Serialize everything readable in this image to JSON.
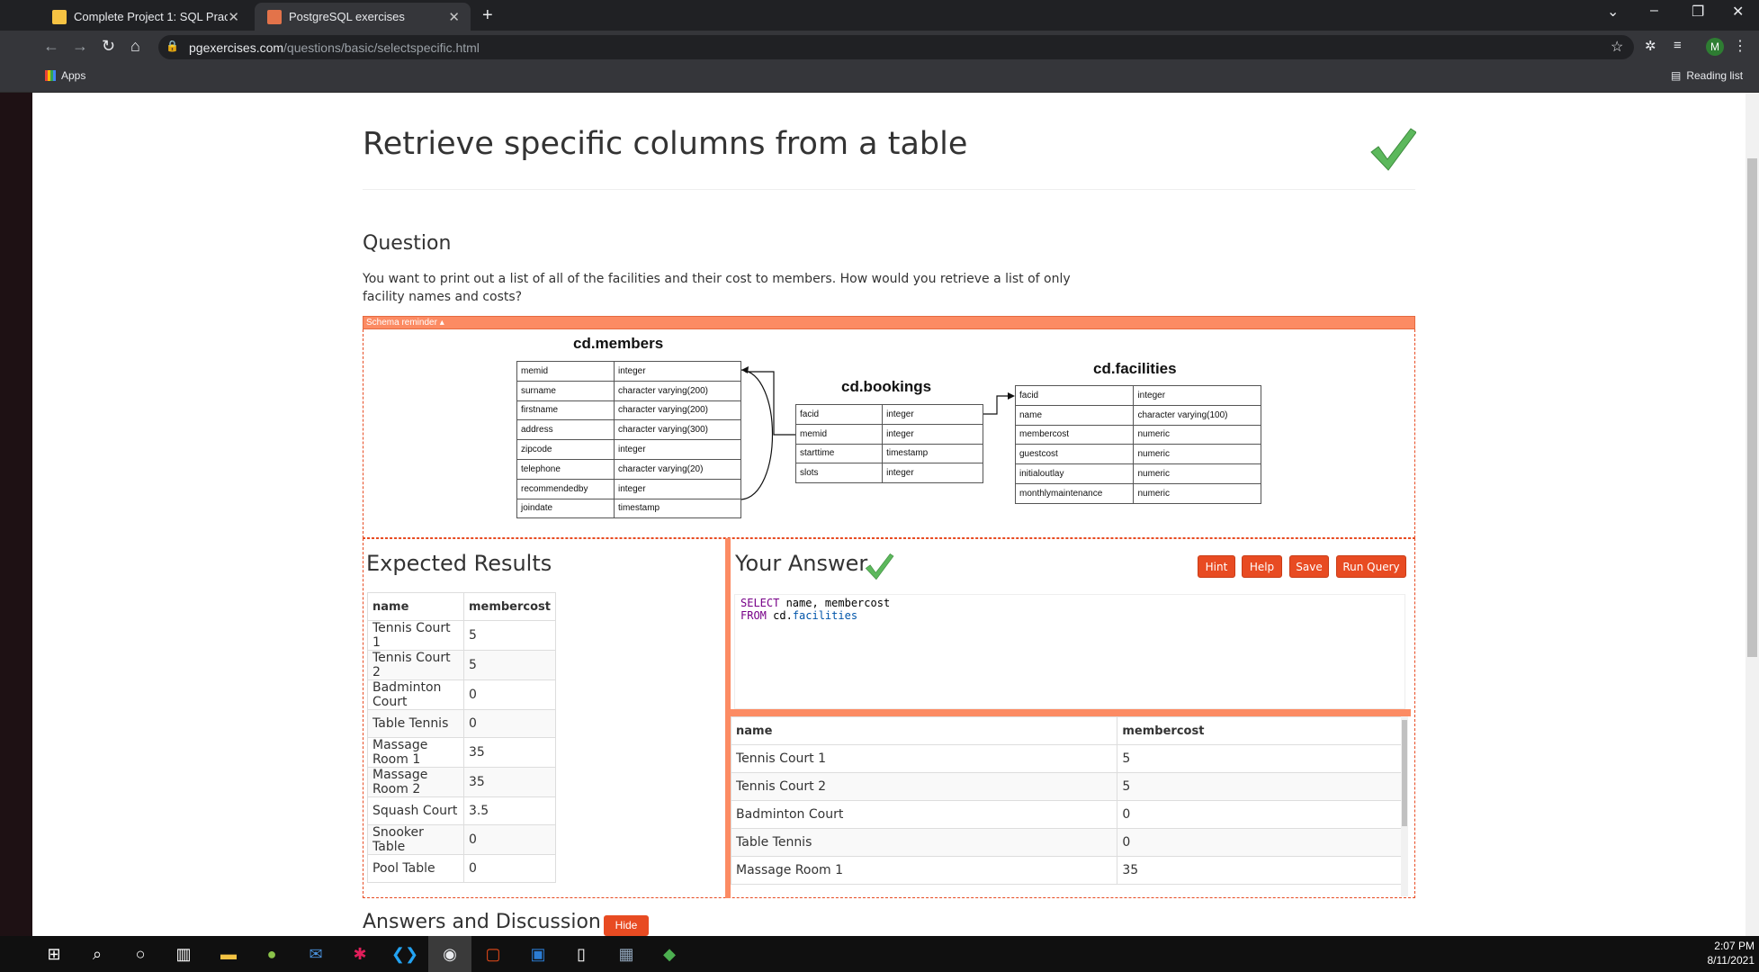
{
  "browser": {
    "tabs": [
      {
        "title": "Complete Project 1: SQL Practice"
      },
      {
        "title": "PostgreSQL exercises"
      }
    ],
    "url_host": "pgexercises.com",
    "url_path": "/questions/basic/selectspecific.html",
    "bookmarks_apps": "Apps",
    "reading_list": "Reading list",
    "avatar_letter": "M"
  },
  "page": {
    "title": "Retrieve specific columns from a table",
    "question_heading": "Question",
    "question_text": "You want to print out a list of all of the facilities and their cost to members. How would you retrieve a list of only facility names and costs?",
    "schema_reminder": "Schema reminder ▴",
    "schema": {
      "members": {
        "title": "cd.members",
        "rows": [
          [
            "memid",
            "integer"
          ],
          [
            "surname",
            "character varying(200)"
          ],
          [
            "firstname",
            "character varying(200)"
          ],
          [
            "address",
            "character varying(300)"
          ],
          [
            "zipcode",
            "integer"
          ],
          [
            "telephone",
            "character varying(20)"
          ],
          [
            "recommendedby",
            "integer"
          ],
          [
            "joindate",
            "timestamp"
          ]
        ]
      },
      "bookings": {
        "title": "cd.bookings",
        "rows": [
          [
            "facid",
            "integer"
          ],
          [
            "memid",
            "integer"
          ],
          [
            "starttime",
            "timestamp"
          ],
          [
            "slots",
            "integer"
          ]
        ]
      },
      "facilities": {
        "title": "cd.facilities",
        "rows": [
          [
            "facid",
            "integer"
          ],
          [
            "name",
            "character varying(100)"
          ],
          [
            "membercost",
            "numeric"
          ],
          [
            "guestcost",
            "numeric"
          ],
          [
            "initialoutlay",
            "numeric"
          ],
          [
            "monthlymaintenance",
            "numeric"
          ]
        ]
      }
    },
    "expected_heading": "Expected Results",
    "your_answer_heading": "Your Answer",
    "buttons": {
      "hint": "Hint",
      "help": "Help",
      "save": "Save",
      "run": "Run Query"
    },
    "query": {
      "kw1": "SELECT",
      "line1": " name, membercost",
      "kw2": "FROM",
      "schema": " cd.",
      "table": "facilities"
    },
    "columns": [
      "name",
      "membercost"
    ],
    "expected_rows": [
      [
        "Tennis Court 1",
        "5"
      ],
      [
        "Tennis Court 2",
        "5"
      ],
      [
        "Badminton Court",
        "0"
      ],
      [
        "Table Tennis",
        "0"
      ],
      [
        "Massage Room 1",
        "35"
      ],
      [
        "Massage Room 2",
        "35"
      ],
      [
        "Squash Court",
        "3.5"
      ],
      [
        "Snooker Table",
        "0"
      ],
      [
        "Pool Table",
        "0"
      ]
    ],
    "answer_rows": [
      [
        "Tennis Court 1",
        "5"
      ],
      [
        "Tennis Court 2",
        "5"
      ],
      [
        "Badminton Court",
        "0"
      ],
      [
        "Table Tennis",
        "0"
      ],
      [
        "Massage Room 1",
        "35"
      ]
    ],
    "discussion_heading": "Answers and Discussion",
    "hide_label": "Hide"
  },
  "taskbar": {
    "time": "2:07 PM",
    "date": "8/11/2021"
  },
  "colors": {
    "accent": "#e84b22",
    "accent_light": "#fc8b63",
    "check": "#5cb85c"
  }
}
